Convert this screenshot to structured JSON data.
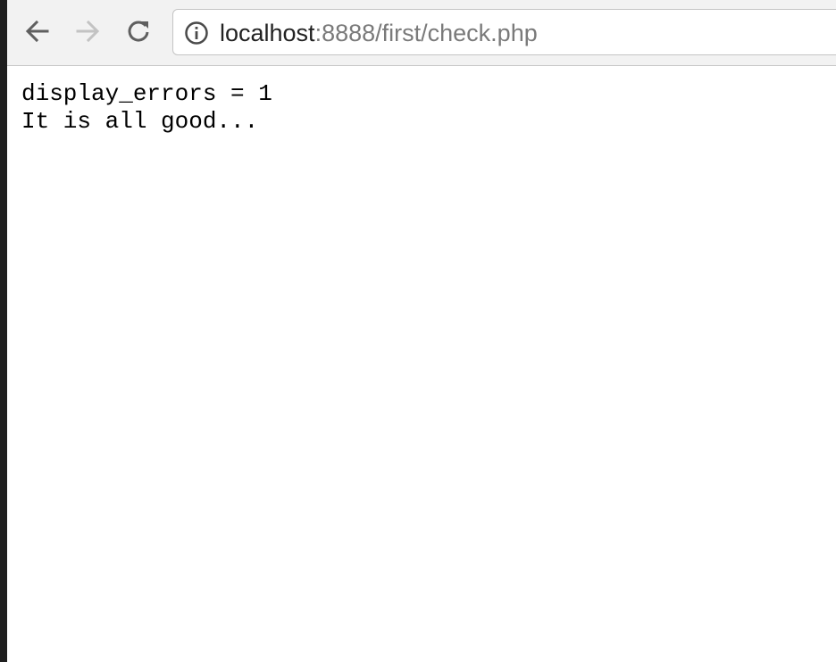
{
  "address_bar": {
    "host": "localhost",
    "path": ":8888/first/check.php"
  },
  "toolbar": {
    "back_icon": "back-arrow-icon",
    "forward_icon": "forward-arrow-icon",
    "reload_icon": "reload-icon",
    "info_icon": "info-icon"
  },
  "page": {
    "lines": [
      "display_errors = 1",
      "It is all good..."
    ]
  }
}
